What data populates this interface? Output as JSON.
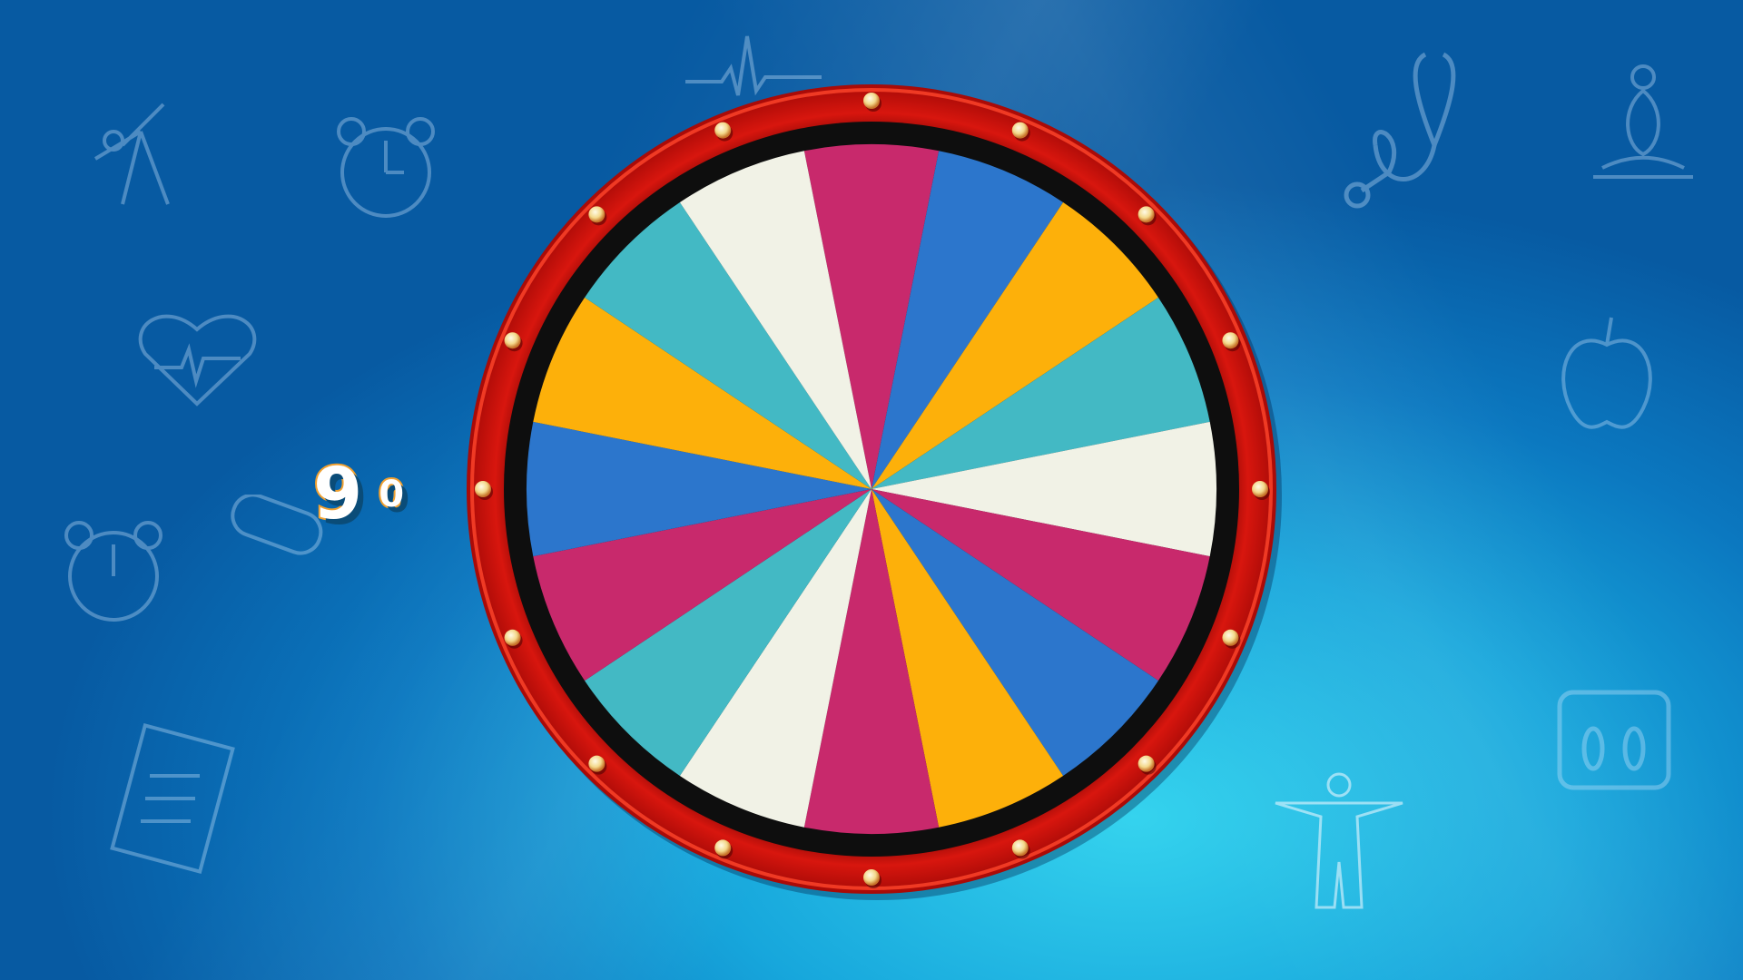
{
  "counter": {
    "main": "9",
    "sub": "0"
  },
  "wheel": {
    "segments": [
      "magenta",
      "blue",
      "yellow",
      "teal",
      "white",
      "magenta",
      "blue",
      "yellow",
      "magenta",
      "white",
      "teal",
      "magenta",
      "blue",
      "yellow",
      "teal",
      "white"
    ],
    "bolt_count": 16
  },
  "colors": {
    "magenta": "#c8296c",
    "blue": "#2c76cc",
    "yellow": "#fdb00a",
    "teal": "#43b9c4",
    "white": "#f1f2e6",
    "rim": "#c40f0a",
    "rim_inner": "#111111",
    "bolt": "#f7e9b0"
  },
  "background_icons": [
    "stretching-person-icon",
    "alarm-clock-icon",
    "heart-rate-icon",
    "pill-icon",
    "clipboard-checklist-icon",
    "ecg-line-icon",
    "stethoscope-icon",
    "yoga-icon",
    "apple-icon",
    "scale-icon",
    "body-icon"
  ]
}
